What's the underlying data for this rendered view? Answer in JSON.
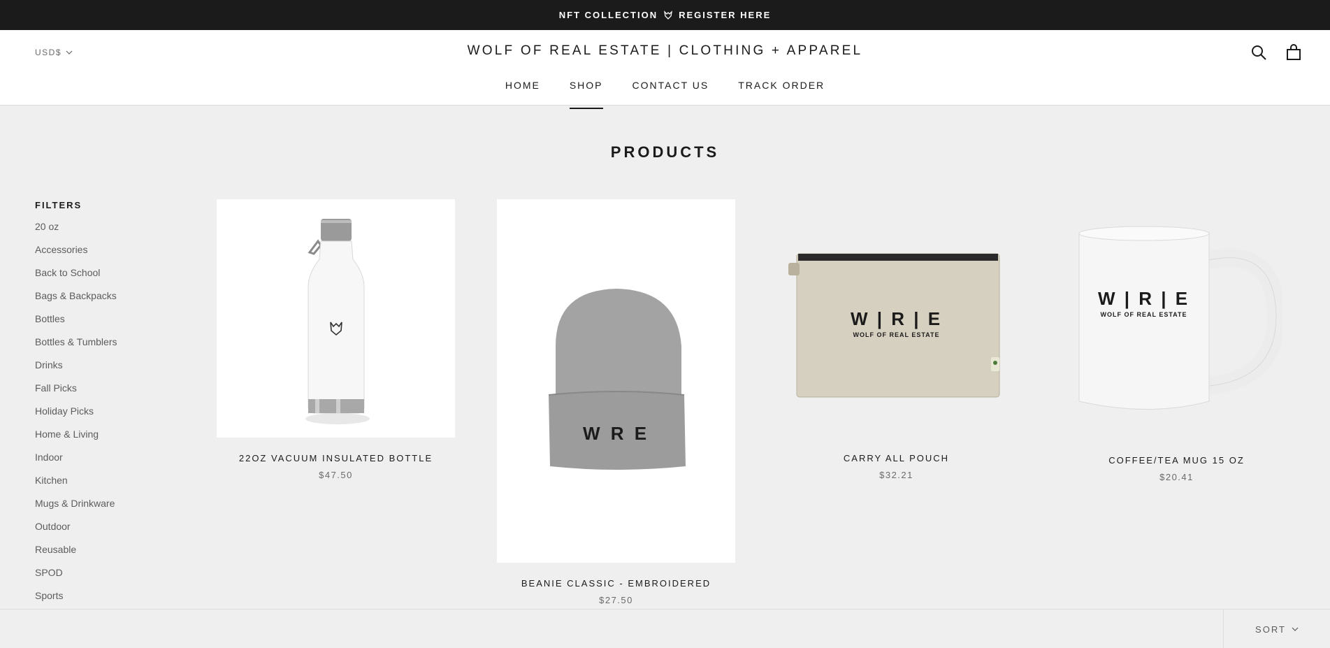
{
  "announcement": {
    "left": "NFT COLLECTION",
    "right": "REGISTER HERE"
  },
  "header": {
    "currency": "USD$",
    "brand": "WOLF OF REAL ESTATE | CLOTHING + APPAREL",
    "nav": [
      {
        "label": "HOME",
        "active": false
      },
      {
        "label": "SHOP",
        "active": true
      },
      {
        "label": "CONTACT US",
        "active": false
      },
      {
        "label": "TRACK ORDER",
        "active": false
      }
    ]
  },
  "page": {
    "title": "PRODUCTS"
  },
  "filters": {
    "title": "FILTERS",
    "items": [
      "20 oz",
      "Accessories",
      "Back to School",
      "Bags & Backpacks",
      "Bottles",
      "Bottles & Tumblers",
      "Drinks",
      "Fall Picks",
      "Holiday Picks",
      "Home & Living",
      "Indoor",
      "Kitchen",
      "Mugs & Drinkware",
      "Outdoor",
      "Reusable",
      "SPOD",
      "Sports"
    ]
  },
  "products": [
    {
      "name": "22OZ VACUUM INSULATED BOTTLE",
      "price": "$47.50"
    },
    {
      "name": "BEANIE CLASSIC - EMBROIDERED",
      "price": "$27.50",
      "logo": "W R E"
    },
    {
      "name": "CARRY ALL POUCH",
      "price": "$32.21",
      "logo": "W | R | E",
      "logo_sub": "WOLF OF REAL ESTATE"
    },
    {
      "name": "COFFEE/TEA MUG 15 OZ",
      "price": "$20.41",
      "logo": "W | R | E",
      "logo_sub": "WOLF OF REAL ESTATE"
    }
  ],
  "sort": {
    "label": "SORT"
  },
  "colors": {
    "topbar": "#1c1b1b",
    "page_bg": "#efefef",
    "text": "#1c1b1b",
    "muted": "#6a6a6a"
  }
}
